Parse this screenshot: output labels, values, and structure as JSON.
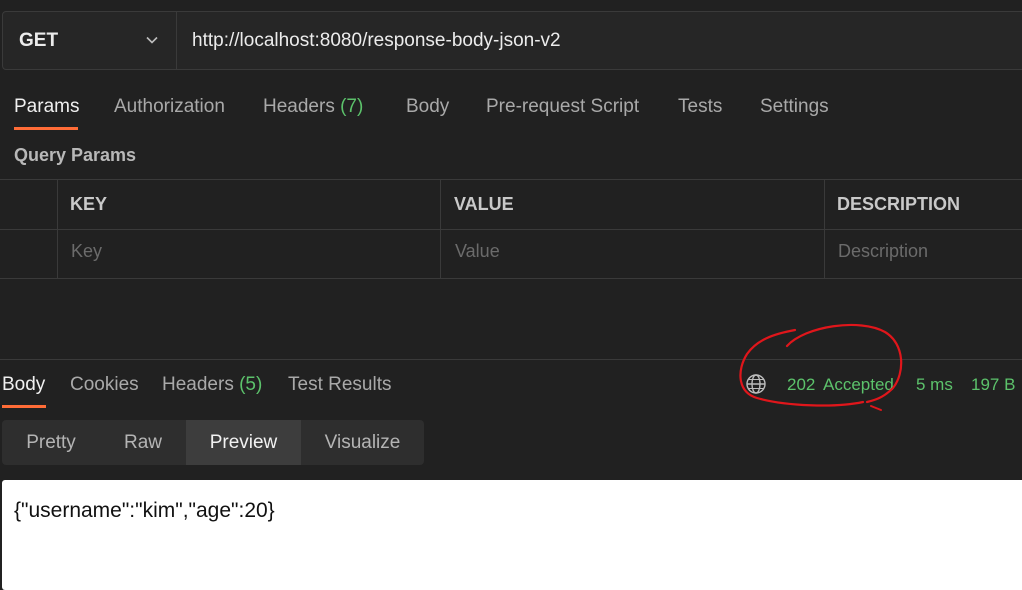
{
  "request": {
    "method": "GET",
    "url": "http://localhost:8080/response-body-json-v2"
  },
  "request_tabs": [
    {
      "label": "Params",
      "active": true
    },
    {
      "label": "Authorization"
    },
    {
      "label": "Headers",
      "count": "(7)"
    },
    {
      "label": "Body"
    },
    {
      "label": "Pre-request Script"
    },
    {
      "label": "Tests"
    },
    {
      "label": "Settings"
    }
  ],
  "query_params": {
    "title": "Query Params",
    "columns": [
      "KEY",
      "VALUE",
      "DESCRIPTION"
    ],
    "placeholders": [
      "Key",
      "Value",
      "Description"
    ]
  },
  "response_tabs": [
    {
      "label": "Body",
      "active": true
    },
    {
      "label": "Cookies"
    },
    {
      "label": "Headers",
      "count": "(5)"
    },
    {
      "label": "Test Results"
    }
  ],
  "status": {
    "code": "202",
    "text": "Accepted",
    "time": "5 ms",
    "size": "197 B",
    "color": "#5cc26b"
  },
  "view_modes": [
    "Pretty",
    "Raw",
    "Preview",
    "Visualize"
  ],
  "active_view": "Preview",
  "response_body": "{\"username\":\"kim\",\"age\":20}",
  "colors": {
    "accent": "#ff6c37",
    "annotation": "#e0161b",
    "background": "#212121"
  }
}
